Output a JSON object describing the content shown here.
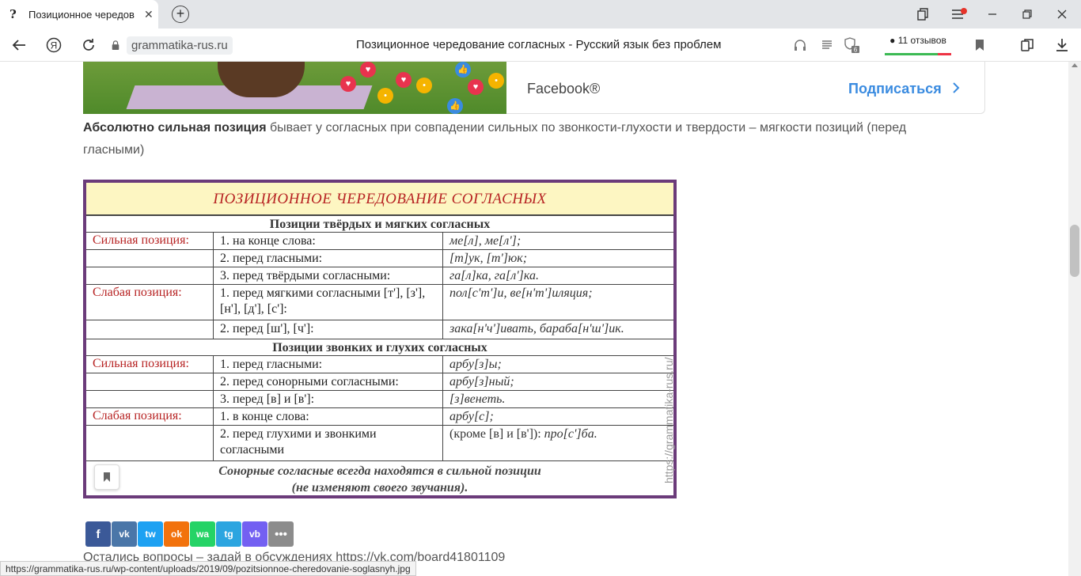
{
  "tab": {
    "favicon": "?",
    "title": "Позиционное чередов",
    "close": "✕"
  },
  "window": {
    "new_tab": "+",
    "icons": [
      "collections-icon",
      "menu-icon",
      "minimize-icon",
      "maximize-icon",
      "close-icon"
    ]
  },
  "navbar": {
    "url": "grammatika-rus.ru",
    "page_title": "Позиционное чередование согласных - Русский язык без проблем",
    "reviews": "11 отзывов",
    "tabs_count": "6"
  },
  "banner": {
    "brand": "Facebook®",
    "subscribe": "Подписаться"
  },
  "paragraph": {
    "bold": "Абсолютно сильная позиция",
    "rest": " бывает у согласных при совпадении сильных по звонкости-глухости и твердости – мягкости позиций (перед гласными)"
  },
  "table": {
    "title": "Позиционное чередование согласных",
    "section1": "Позиции твёрдых и мягких согласных",
    "section2": "Позиции звонких и глухих согласных",
    "rows1": [
      {
        "pos": "Сильная позиция:",
        "desc": "1. на конце слова:",
        "ex": "ме[л], ме[л'];"
      },
      {
        "pos": "",
        "desc": "2. перед гласными:",
        "ex": "[т]ук, [т']юк;"
      },
      {
        "pos": "",
        "desc": "3. перед твёрдыми согласными:",
        "ex": "га[л]ка, га[л']ка."
      },
      {
        "pos": "Слабая позиция:",
        "desc": "1. перед мягкими согласными [т'], [з'], [н'], [д'], [с']:",
        "ex": "пол[с'т']и, ве[н'т']иляция;"
      },
      {
        "pos": "",
        "desc": "2. перед [ш'], [ч']:",
        "ex": "зака[н'ч']ивать, бараба[н'ш']ик."
      }
    ],
    "rows2": [
      {
        "pos": "Сильная позиция:",
        "desc": "1. перед гласными:",
        "ex": "арбу[з]ы;"
      },
      {
        "pos": "",
        "desc": "2. перед сонорными согласными:",
        "ex": "арбу[з]ный;"
      },
      {
        "pos": "",
        "desc": "3. перед [в] и [в']:",
        "ex": "[з]венеть."
      },
      {
        "pos": "Слабая позиция:",
        "desc": "1. в конце слова:",
        "ex": "арбу[с];"
      },
      {
        "pos": "",
        "desc": "2. перед глухими и звонкими согласными",
        "ex_plain": "(кроме [в] и [в']): ",
        "ex": "про[с']ба."
      }
    ],
    "footnote1": "Сонорные согласные всегда находятся в сильной позиции",
    "footnote2": "(не изменяют своего звучания).",
    "watermark": "https://grammatika-rus.ru/"
  },
  "share": [
    "f",
    "vk",
    "tw",
    "ok",
    "wa",
    "tg",
    "vb",
    "•••"
  ],
  "bottom_text": "Остались вопросы – задай в обсуждениях https://vk.com/board41801109",
  "status_url": "https://grammatika-rus.ru/wp-content/uploads/2019/09/pozitsionnoe-cheredovanie-soglasnyh.jpg",
  "colors": {
    "accent_blue": "#3a8be0",
    "table_border": "#6b3b7a",
    "table_red": "#b72323"
  }
}
